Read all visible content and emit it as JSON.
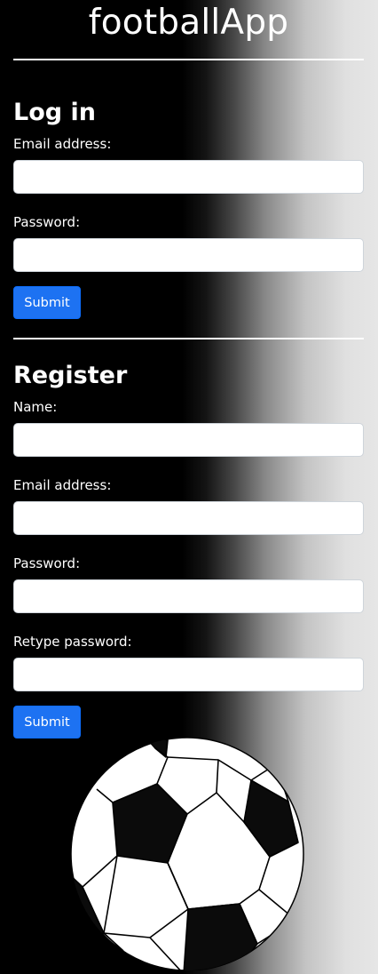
{
  "app": {
    "title": "footballApp"
  },
  "login": {
    "heading": "Log in",
    "email_label": "Email address:",
    "password_label": "Password:",
    "email_value": "",
    "password_value": "",
    "submit_label": "Submit"
  },
  "register": {
    "heading": "Register",
    "name_label": "Name:",
    "email_label": "Email address:",
    "password_label": "Password:",
    "retype_label": "Retype password:",
    "name_value": "",
    "email_value": "",
    "password_value": "",
    "retype_value": "",
    "submit_label": "Submit"
  },
  "images": {
    "ball_icon": "soccer-ball-icon"
  },
  "colors": {
    "primary_button": "#1d72f2",
    "text": "#ffffff",
    "background_left": "#000000",
    "background_right": "#e6e6e6"
  }
}
